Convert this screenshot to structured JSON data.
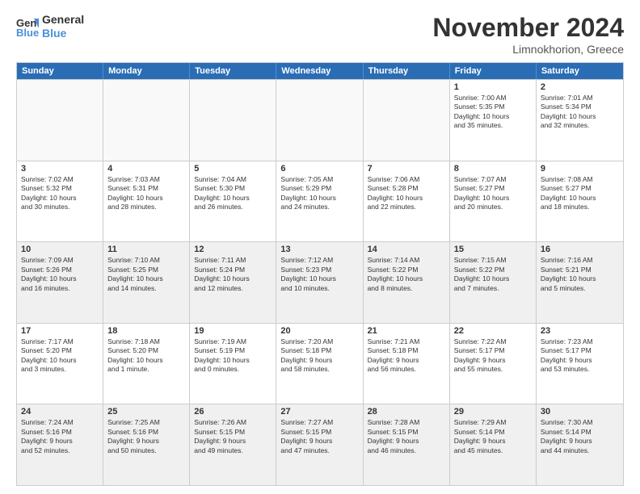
{
  "header": {
    "logo_line1": "General",
    "logo_line2": "Blue",
    "month": "November 2024",
    "location": "Limnokhorion, Greece"
  },
  "weekdays": [
    "Sunday",
    "Monday",
    "Tuesday",
    "Wednesday",
    "Thursday",
    "Friday",
    "Saturday"
  ],
  "weeks": [
    [
      {
        "day": "",
        "info": ""
      },
      {
        "day": "",
        "info": ""
      },
      {
        "day": "",
        "info": ""
      },
      {
        "day": "",
        "info": ""
      },
      {
        "day": "",
        "info": ""
      },
      {
        "day": "1",
        "info": "Sunrise: 7:00 AM\nSunset: 5:35 PM\nDaylight: 10 hours\nand 35 minutes."
      },
      {
        "day": "2",
        "info": "Sunrise: 7:01 AM\nSunset: 5:34 PM\nDaylight: 10 hours\nand 32 minutes."
      }
    ],
    [
      {
        "day": "3",
        "info": "Sunrise: 7:02 AM\nSunset: 5:32 PM\nDaylight: 10 hours\nand 30 minutes."
      },
      {
        "day": "4",
        "info": "Sunrise: 7:03 AM\nSunset: 5:31 PM\nDaylight: 10 hours\nand 28 minutes."
      },
      {
        "day": "5",
        "info": "Sunrise: 7:04 AM\nSunset: 5:30 PM\nDaylight: 10 hours\nand 26 minutes."
      },
      {
        "day": "6",
        "info": "Sunrise: 7:05 AM\nSunset: 5:29 PM\nDaylight: 10 hours\nand 24 minutes."
      },
      {
        "day": "7",
        "info": "Sunrise: 7:06 AM\nSunset: 5:28 PM\nDaylight: 10 hours\nand 22 minutes."
      },
      {
        "day": "8",
        "info": "Sunrise: 7:07 AM\nSunset: 5:27 PM\nDaylight: 10 hours\nand 20 minutes."
      },
      {
        "day": "9",
        "info": "Sunrise: 7:08 AM\nSunset: 5:27 PM\nDaylight: 10 hours\nand 18 minutes."
      }
    ],
    [
      {
        "day": "10",
        "info": "Sunrise: 7:09 AM\nSunset: 5:26 PM\nDaylight: 10 hours\nand 16 minutes."
      },
      {
        "day": "11",
        "info": "Sunrise: 7:10 AM\nSunset: 5:25 PM\nDaylight: 10 hours\nand 14 minutes."
      },
      {
        "day": "12",
        "info": "Sunrise: 7:11 AM\nSunset: 5:24 PM\nDaylight: 10 hours\nand 12 minutes."
      },
      {
        "day": "13",
        "info": "Sunrise: 7:12 AM\nSunset: 5:23 PM\nDaylight: 10 hours\nand 10 minutes."
      },
      {
        "day": "14",
        "info": "Sunrise: 7:14 AM\nSunset: 5:22 PM\nDaylight: 10 hours\nand 8 minutes."
      },
      {
        "day": "15",
        "info": "Sunrise: 7:15 AM\nSunset: 5:22 PM\nDaylight: 10 hours\nand 7 minutes."
      },
      {
        "day": "16",
        "info": "Sunrise: 7:16 AM\nSunset: 5:21 PM\nDaylight: 10 hours\nand 5 minutes."
      }
    ],
    [
      {
        "day": "17",
        "info": "Sunrise: 7:17 AM\nSunset: 5:20 PM\nDaylight: 10 hours\nand 3 minutes."
      },
      {
        "day": "18",
        "info": "Sunrise: 7:18 AM\nSunset: 5:20 PM\nDaylight: 10 hours\nand 1 minute."
      },
      {
        "day": "19",
        "info": "Sunrise: 7:19 AM\nSunset: 5:19 PM\nDaylight: 10 hours\nand 0 minutes."
      },
      {
        "day": "20",
        "info": "Sunrise: 7:20 AM\nSunset: 5:18 PM\nDaylight: 9 hours\nand 58 minutes."
      },
      {
        "day": "21",
        "info": "Sunrise: 7:21 AM\nSunset: 5:18 PM\nDaylight: 9 hours\nand 56 minutes."
      },
      {
        "day": "22",
        "info": "Sunrise: 7:22 AM\nSunset: 5:17 PM\nDaylight: 9 hours\nand 55 minutes."
      },
      {
        "day": "23",
        "info": "Sunrise: 7:23 AM\nSunset: 5:17 PM\nDaylight: 9 hours\nand 53 minutes."
      }
    ],
    [
      {
        "day": "24",
        "info": "Sunrise: 7:24 AM\nSunset: 5:16 PM\nDaylight: 9 hours\nand 52 minutes."
      },
      {
        "day": "25",
        "info": "Sunrise: 7:25 AM\nSunset: 5:16 PM\nDaylight: 9 hours\nand 50 minutes."
      },
      {
        "day": "26",
        "info": "Sunrise: 7:26 AM\nSunset: 5:15 PM\nDaylight: 9 hours\nand 49 minutes."
      },
      {
        "day": "27",
        "info": "Sunrise: 7:27 AM\nSunset: 5:15 PM\nDaylight: 9 hours\nand 47 minutes."
      },
      {
        "day": "28",
        "info": "Sunrise: 7:28 AM\nSunset: 5:15 PM\nDaylight: 9 hours\nand 46 minutes."
      },
      {
        "day": "29",
        "info": "Sunrise: 7:29 AM\nSunset: 5:14 PM\nDaylight: 9 hours\nand 45 minutes."
      },
      {
        "day": "30",
        "info": "Sunrise: 7:30 AM\nSunset: 5:14 PM\nDaylight: 9 hours\nand 44 minutes."
      }
    ]
  ]
}
